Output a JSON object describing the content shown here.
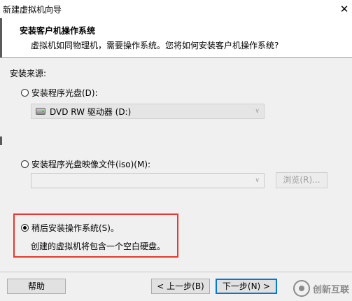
{
  "window": {
    "title": "新建虚拟机向导",
    "close_glyph": "✕"
  },
  "header": {
    "title": "安装客户机操作系统",
    "subtitle": "虚拟机如同物理机，需要操作系统。您将如何安装客户机操作系统?"
  },
  "install_source": {
    "label": "安装来源:",
    "options": [
      {
        "label": "安装程序光盘(D):",
        "selected": false
      },
      {
        "label": "安装程序光盘映像文件(iso)(M):",
        "selected": false
      },
      {
        "label": "稍后安装操作系统(S)。",
        "selected": true
      }
    ],
    "disc_dropdown_value": "DVD RW 驱动器 (D:)",
    "iso_dropdown_value": "",
    "browse_button": "浏览(R)...",
    "later_description": "创建的虚拟机将包含一个空白硬盘。"
  },
  "footer": {
    "help_button": "帮助",
    "back_button": "< 上一步(B)",
    "next_button": "下一步(N) >"
  },
  "watermark": {
    "text": "创新互联"
  },
  "colors": {
    "highlight_border": "#e53935",
    "primary_button_border": "#0078d7"
  }
}
